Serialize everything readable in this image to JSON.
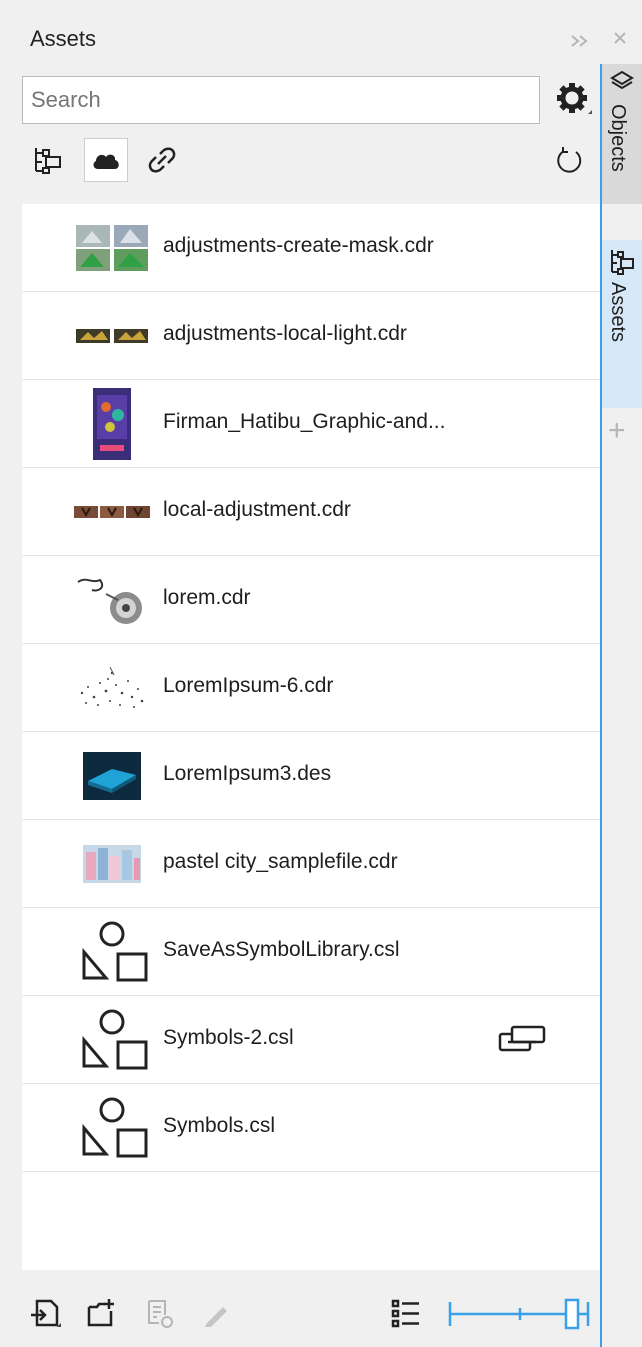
{
  "window": {
    "title": "Assets",
    "expand_icon": "double-chevron-right-icon",
    "close_icon": "close-icon"
  },
  "search": {
    "placeholder": "Search",
    "value": ""
  },
  "toolbar": {
    "icons": [
      "tree-view-icon",
      "cloud-icon",
      "link-icon",
      "refresh-icon",
      "gear-icon"
    ],
    "active": "cloud-icon"
  },
  "assets": [
    {
      "name": "adjustments-create-mask.cdr",
      "thumb": "image-grid-thumbnail"
    },
    {
      "name": "adjustments-local-light.cdr",
      "thumb": "image-pair-thumbnail"
    },
    {
      "name": "Firman_Hatibu_Graphic-and...",
      "thumb": "poster-thumbnail"
    },
    {
      "name": "local-adjustment.cdr",
      "thumb": "image-strip-thumbnail"
    },
    {
      "name": "lorem.cdr",
      "thumb": "sketch-thumbnail"
    },
    {
      "name": "LoremIpsum-6.cdr",
      "thumb": "scatter-thumbnail"
    },
    {
      "name": "LoremIpsum3.des",
      "thumb": "blue-render-thumbnail"
    },
    {
      "name": "pastel city_samplefile.cdr",
      "thumb": "pastel-city-thumbnail"
    },
    {
      "name": "SaveAsSymbolLibrary.csl",
      "thumb": "symbol-library-icon"
    },
    {
      "name": "Symbols-2.csl",
      "thumb": "symbol-library-icon",
      "linked": true
    },
    {
      "name": "Symbols.csl",
      "thumb": "symbol-library-icon"
    }
  ],
  "bottom": {
    "icons": [
      "import-icon",
      "new-library-icon",
      "properties-icon",
      "edit-icon",
      "list-view-icon"
    ],
    "thumbnail_size": 0.85
  },
  "side_tabs": [
    {
      "label": "Objects",
      "icon": "layers-icon"
    },
    {
      "label": "Assets",
      "icon": "tree-view-icon",
      "active": true
    }
  ],
  "colors": {
    "accent": "#3aa0e8",
    "active_tab": "#d6e8f8"
  }
}
